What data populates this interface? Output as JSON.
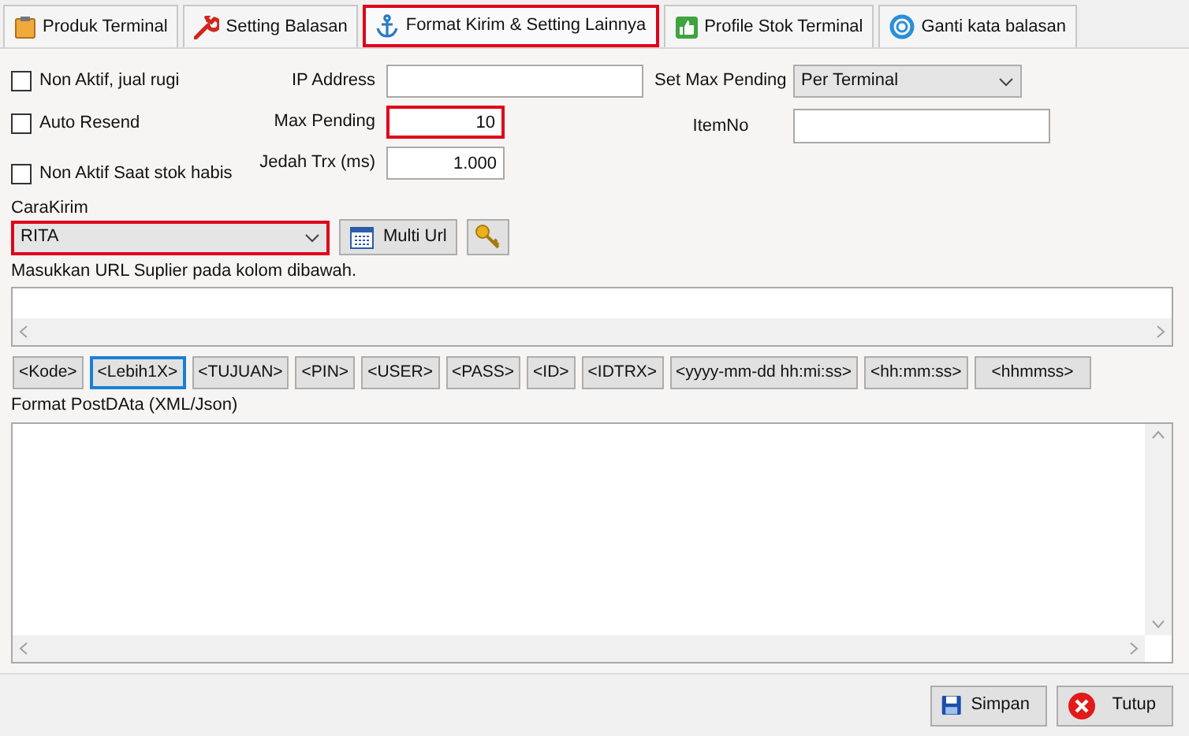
{
  "tabs": [
    {
      "label": "Produk Terminal",
      "selected": false
    },
    {
      "label": "Setting Balasan",
      "selected": false
    },
    {
      "label": "Format Kirim & Setting Lainnya",
      "selected": true
    },
    {
      "label": "Profile Stok Terminal",
      "selected": false
    },
    {
      "label": "Ganti kata balasan",
      "selected": false
    }
  ],
  "checkboxes": [
    {
      "label": "Non Aktif, jual rugi",
      "checked": false
    },
    {
      "label": "Auto Resend",
      "checked": false
    },
    {
      "label": "Non Aktif Saat stok habis",
      "checked": false
    }
  ],
  "fields": [
    {
      "label": "IP Address",
      "highlighted": false
    },
    {
      "label": "Max Pending",
      "value": "10",
      "highlighted": true
    },
    {
      "label": "Jedah Trx (ms)",
      "value": "1.000",
      "highlighted": false
    }
  ],
  "set_max_pending": {
    "label": "Set Max Pending",
    "value": "Per Terminal"
  },
  "item_no": {
    "label": "ItemNo"
  },
  "cara_kirim": {
    "label": "CaraKirim",
    "value": "RITA",
    "highlighted": true
  },
  "multi_url_button": "Multi Url",
  "url_hint": "Masukkan URL Suplier pada kolom dibawah.",
  "tokens": [
    {
      "label": "<Kode>",
      "focused": false
    },
    {
      "label": "<Lebih1X>",
      "focused": true
    },
    {
      "label": "<TUJUAN>",
      "focused": false
    },
    {
      "label": "<PIN>",
      "focused": false
    },
    {
      "label": "<USER>",
      "focused": false
    },
    {
      "label": "<PASS>",
      "focused": false
    },
    {
      "label": "<ID>",
      "focused": false
    },
    {
      "label": "<IDTRX>",
      "focused": false
    },
    {
      "label": "<yyyy-mm-dd hh:mi:ss>",
      "focused": false
    },
    {
      "label": "<hh:mm:ss>",
      "focused": false
    },
    {
      "label": "<hhmmss>",
      "focused": false
    }
  ],
  "post_data_label": "Format PostDAta (XML/Json)",
  "buttons": [
    {
      "label": "Simpan",
      "kind": "save"
    },
    {
      "label": "Tutup",
      "kind": "close"
    }
  ]
}
